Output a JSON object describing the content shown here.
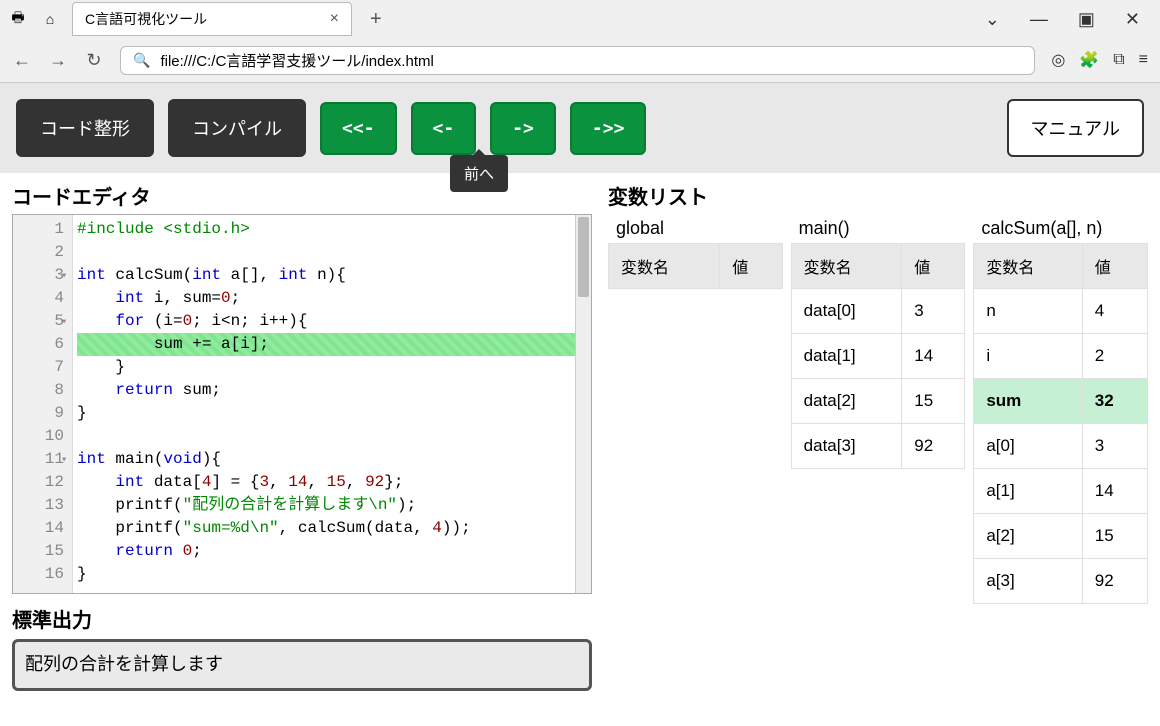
{
  "browser": {
    "tab_title": "C言語可視化ツール",
    "url": "file:///C:/C言語学習支援ツール/index.html"
  },
  "toolbar": {
    "format": "コード整形",
    "compile": "コンパイル",
    "rewind": "<<-",
    "prev": "<-",
    "next": "->",
    "fastfwd": "->>",
    "manual": "マニュアル",
    "tooltip_prev": "前へ"
  },
  "editor": {
    "title": "コードエディタ",
    "highlighted_line": 6,
    "lines": [
      {
        "n": 1,
        "fold": false
      },
      {
        "n": 2,
        "fold": false
      },
      {
        "n": 3,
        "fold": true
      },
      {
        "n": 4,
        "fold": false
      },
      {
        "n": 5,
        "fold": true
      },
      {
        "n": 6,
        "fold": false
      },
      {
        "n": 7,
        "fold": false
      },
      {
        "n": 8,
        "fold": false
      },
      {
        "n": 9,
        "fold": false
      },
      {
        "n": 10,
        "fold": false
      },
      {
        "n": 11,
        "fold": true
      },
      {
        "n": 12,
        "fold": false
      },
      {
        "n": 13,
        "fold": false
      },
      {
        "n": 14,
        "fold": false
      },
      {
        "n": 15,
        "fold": false
      },
      {
        "n": 16,
        "fold": false
      }
    ]
  },
  "stdout": {
    "title": "標準出力",
    "text": "配列の合計を計算します"
  },
  "varlist": {
    "title": "変数リスト",
    "col_name": "変数名",
    "col_value": "値",
    "scopes": [
      {
        "name": "global",
        "vars": []
      },
      {
        "name": "main()",
        "vars": [
          {
            "name": "data[0]",
            "value": "3"
          },
          {
            "name": "data[1]",
            "value": "14"
          },
          {
            "name": "data[2]",
            "value": "15"
          },
          {
            "name": "data[3]",
            "value": "92"
          }
        ]
      },
      {
        "name": "calcSum(a[], n)",
        "vars": [
          {
            "name": "n",
            "value": "4"
          },
          {
            "name": "i",
            "value": "2"
          },
          {
            "name": "sum",
            "value": "32",
            "hl": true
          },
          {
            "name": "a[0]",
            "value": "3"
          },
          {
            "name": "a[1]",
            "value": "14"
          },
          {
            "name": "a[2]",
            "value": "15"
          },
          {
            "name": "a[3]",
            "value": "92"
          }
        ]
      }
    ]
  }
}
